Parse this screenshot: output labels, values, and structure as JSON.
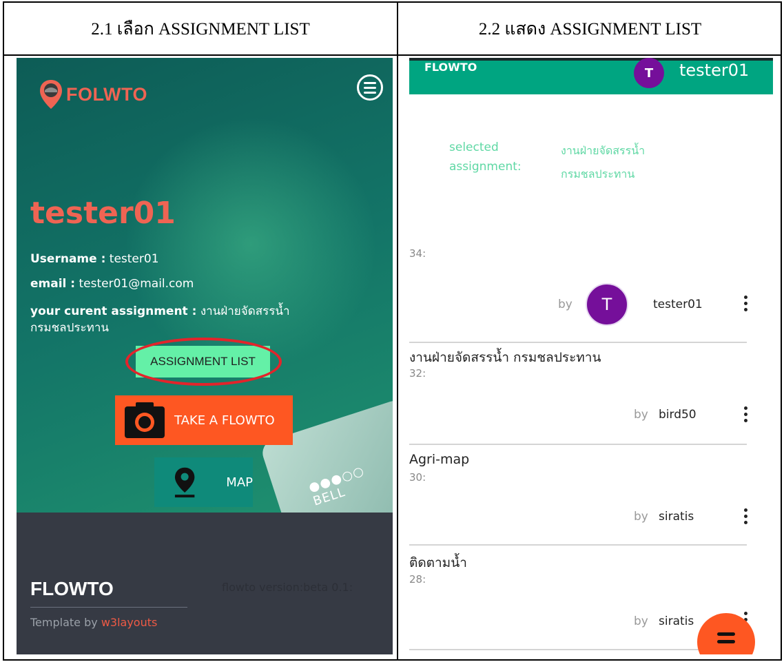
{
  "headers": {
    "left": "2.1 เลือก ASSIGNMENT LIST",
    "right": "2.2 แสดง ASSIGNMENT LIST"
  },
  "left_screen": {
    "logo_text": "FOLWTO",
    "username_display": "tester01",
    "username_label": "Username :",
    "username_value": "tester01",
    "email_label": "email :",
    "email_value": "tester01@mail.com",
    "assignment_label": "your curent assignment :",
    "assignment_value_line1": "งานฝ่ายจัดสรรน้ำ",
    "assignment_value_line2": "กรมชลประทาน",
    "assignment_list_button": "ASSIGNMENT LIST",
    "take_button": "TAKE A FLOWTO",
    "map_button": "MAP",
    "phone_deco_text": "●●●○○ BELL",
    "footer": {
      "brand": "FLOWTO",
      "version": "flowto version:beta 0.1:",
      "template_prefix": "Template by",
      "template_link": "w3layouts"
    },
    "colors": {
      "accent": "#ef6453",
      "assignment_button": "#64f0a7",
      "take_button": "#fe5722",
      "map_button": "#0f8a7a",
      "highlight_circle": "#e3242b"
    }
  },
  "right_screen": {
    "app_brand": "FLOWTO",
    "avatar_letter": "T",
    "current_user": "tester01",
    "selected_label_line1": "selected",
    "selected_label_line2": "assignment:",
    "selected_value_line1": "งานฝ่ายจัดสรรน้ำ",
    "selected_value_line2": "กรมชลประทาน",
    "by_word": "by",
    "items": [
      {
        "title": "",
        "number": "34:",
        "author": "tester01",
        "avatar": "T"
      },
      {
        "title": "งานฝ่ายจัดสรรน้ำ กรมชลประทาน",
        "number": "32:",
        "author": "bird50"
      },
      {
        "title": "Agri-map",
        "number": "30:",
        "author": "siratis"
      },
      {
        "title": "ติดตามน้ำ",
        "number": "28:",
        "author": "siratis"
      }
    ],
    "colors": {
      "app_bar": "#00a581",
      "avatar": "#750f9a",
      "selected_text": "#5fd8a4",
      "fab": "#fe5722"
    }
  }
}
